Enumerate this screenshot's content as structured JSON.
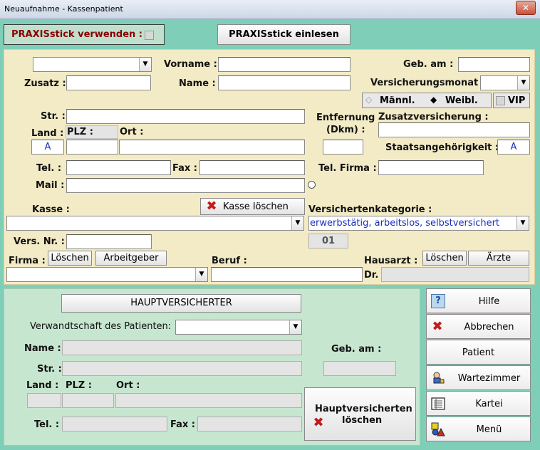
{
  "window": {
    "title": "Neuaufnahme - Kassenpatient",
    "close_label": "✕"
  },
  "praxis": {
    "use_label": "PRAXISstick verwenden :",
    "read_button": "PRAXISstick einlesen"
  },
  "form": {
    "vorname_label": "Vorname :",
    "zusatz_label": "Zusatz :",
    "name_label": "Name :",
    "geb_label": "Geb. am :",
    "versmonat_label": "Versicherungsmonat :",
    "gender_male": "Männl.",
    "gender_female": "Weibl.",
    "vip_label": "VIP",
    "str_label": "Str. :",
    "land_label": "Land :",
    "plz_label": "PLZ :",
    "ort_label": "Ort :",
    "land_value": "A",
    "entfernung_label_1": "Entfernung",
    "entfernung_label_2": "(Dkm) :",
    "zusatzvers_label": "Zusatzversicherung :",
    "staats_label": "Staatsangehörigkeit :",
    "staats_value": "A",
    "tel_label": "Tel. :",
    "fax_label": "Fax :",
    "telfirma_label": "Tel. Firma :",
    "mail_label": "Mail :",
    "kasse_label": "Kasse :",
    "kasse_loeschen": "Kasse löschen",
    "verskat_label": "Versichertenkategorie :",
    "verskat_value": "erwerbstätig, arbeitslos, selbstversichert",
    "verskat_code": "01",
    "versnr_label": "Vers. Nr. :",
    "firma_label": "Firma :",
    "firma_loeschen": "Löschen",
    "arbeitgeber_button": "Arbeitgeber",
    "beruf_label": "Beruf :",
    "hausarzt_label": "Hausarzt :",
    "hausarzt_loeschen": "Löschen",
    "aerzte_button": "Ärzte",
    "dr_label": "Dr."
  },
  "haupt": {
    "title_button": "HAUPTVERSICHERTER",
    "verwandt_label": "Verwandtschaft des Patienten:",
    "name_label": "Name :",
    "geb_label": "Geb. am :",
    "str_label": "Str. :",
    "land_label": "Land :",
    "plz_label": "PLZ :",
    "ort_label": "Ort :",
    "tel_label": "Tel. :",
    "fax_label": "Fax :",
    "delete_line1": "Hauptversicherten",
    "delete_line2": "löschen"
  },
  "sidebar": {
    "hilfe": "Hilfe",
    "abbrechen": "Abbrechen",
    "patient": "Patient",
    "wartezimmer": "Wartezimmer",
    "kartei": "Kartei",
    "menu": "Menü"
  }
}
